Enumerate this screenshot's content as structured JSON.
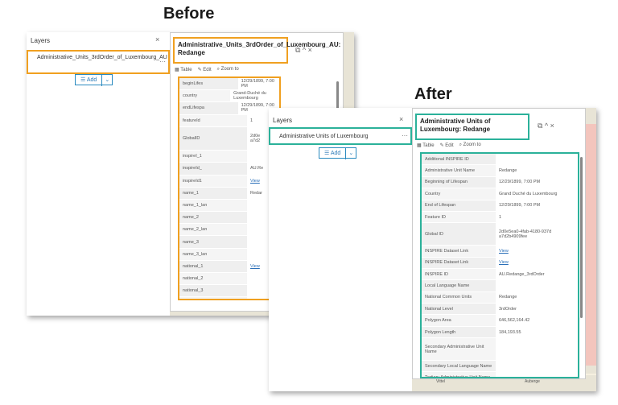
{
  "headings": {
    "before": "Before",
    "after": "After"
  },
  "before": {
    "layers_title": "Layers",
    "close": "×",
    "layer_name": "Administrative_Units_3rdOrder_of_Luxembourg_AU",
    "more": "···",
    "add_label": "Add",
    "add_chevron": "⌄",
    "popup_title": "Administrative_Units_3rdOrder_of_Luxembourg_AU: Redange",
    "popup_icons": "⧉   ^   ×",
    "toolbar": {
      "table": "Table",
      "edit": "Edit",
      "zoom": "Zoom to"
    },
    "attributes": [
      {
        "key": "beginLifes",
        "value": "12/29/1899, 7:00 PM"
      },
      {
        "key": "country",
        "value": "Grand-Duché du Luxembourg"
      },
      {
        "key": "endLifespa",
        "value": "12/29/1899, 7:00 PM"
      },
      {
        "key": "featureId",
        "value": "1"
      },
      {
        "key": "GlobalID",
        "value": "2d0e\na7d2"
      },
      {
        "key": "inspireI_1",
        "value": ""
      },
      {
        "key": "inspireId_",
        "value": "AU.Re"
      },
      {
        "key": "inspireId1",
        "value": "View"
      },
      {
        "key": "name_1",
        "value": "Redar"
      },
      {
        "key": "name_1_lan",
        "value": ""
      },
      {
        "key": "name_2",
        "value": ""
      },
      {
        "key": "name_2_lan",
        "value": ""
      },
      {
        "key": "name_3",
        "value": ""
      },
      {
        "key": "name_3_lan",
        "value": ""
      },
      {
        "key": "national_1",
        "value": "View"
      },
      {
        "key": "national_2",
        "value": ""
      },
      {
        "key": "national_3",
        "value": ""
      },
      {
        "key": "national_4",
        "value": ""
      },
      {
        "key": "national_5",
        "value": ""
      }
    ]
  },
  "after": {
    "layers_title": "Layers",
    "close": "×",
    "layer_name": "Administrative Units of Luxembourg",
    "more": "···",
    "add_label": "Add",
    "add_chevron": "⌄",
    "popup_title": "Administrative Units of Luxembourg: Redange",
    "popup_icons": "⧉   ^   ×",
    "toolbar": {
      "table": "Table",
      "edit": "Edit",
      "zoom": "Zoom to"
    },
    "attributes": [
      {
        "key": "Additional INSPIRE ID",
        "value": ""
      },
      {
        "key": "Administrative Unit Name",
        "value": "Redange"
      },
      {
        "key": "Beginning of Lifespan",
        "value": "12/29/1899, 7:00 PM"
      },
      {
        "key": "Country",
        "value": "Grand Duché du Luxembourg"
      },
      {
        "key": "End of Lifespan",
        "value": "12/29/1899, 7:00 PM"
      },
      {
        "key": "Feature ID",
        "value": "1"
      },
      {
        "key": "Global ID",
        "value": "2d0e5ea0-4fab-4180-937d\na7d2b4909fee"
      },
      {
        "key": "INSPIRE Dataset Link",
        "value": "View"
      },
      {
        "key": "INSPIRE Dataset Link",
        "value": "View"
      },
      {
        "key": "INSPIRE ID",
        "value": "AU.Redange_3rdOrder"
      },
      {
        "key": "Local Language Name",
        "value": ""
      },
      {
        "key": "National Common Units",
        "value": "Redange"
      },
      {
        "key": "National Level",
        "value": "3rdOrder"
      },
      {
        "key": "Polygon Area",
        "value": "646,562,164.42"
      },
      {
        "key": "Polygon Length",
        "value": "184,193.55"
      },
      {
        "key": "Secondary Administrative Unit\nName",
        "value": ""
      },
      {
        "key": "Secondary Local Language Name",
        "value": ""
      },
      {
        "key": "Tertiary Administrative Unit Name",
        "value": ""
      },
      {
        "key": "Tertiary Local Language Name",
        "value": ""
      }
    ],
    "map_labels": {
      "a": "Vittel",
      "b": "Auberge"
    }
  }
}
